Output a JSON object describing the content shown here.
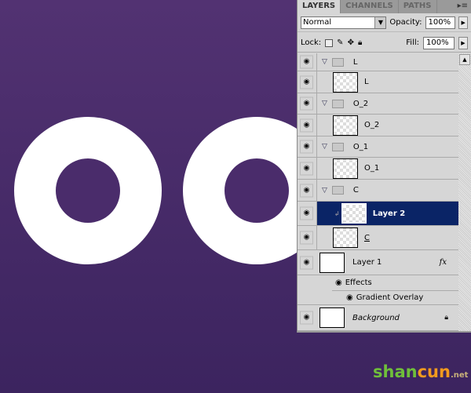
{
  "tabs": [
    "LAYERS",
    "CHANNELS",
    "PATHS"
  ],
  "blend_mode": "Normal",
  "opacity_label": "Opacity:",
  "opacity": "100%",
  "lock_label": "Lock:",
  "fill_label": "Fill:",
  "fill": "100%",
  "layers": [
    {
      "name": "L",
      "type": "group"
    },
    {
      "name": "L",
      "type": "layer"
    },
    {
      "name": "O_2",
      "type": "group"
    },
    {
      "name": "O_2",
      "type": "layer"
    },
    {
      "name": "O_1",
      "type": "group"
    },
    {
      "name": "O_1",
      "type": "layer"
    },
    {
      "name": "C",
      "type": "group"
    },
    {
      "name": "Layer 2",
      "type": "layer",
      "selected": true
    },
    {
      "name": "C",
      "type": "layer"
    },
    {
      "name": "Layer 1",
      "type": "layer",
      "fx": "fx"
    },
    {
      "name": "Effects",
      "type": "effects"
    },
    {
      "name": "Gradient Overlay",
      "type": "effect"
    },
    {
      "name": "Background",
      "type": "background"
    }
  ],
  "watermark": {
    "shan": "shan",
    "cun": "cun",
    "suffix": ".net"
  },
  "colors": {
    "bg_top": "#523272",
    "bg_bottom": "#3c245f",
    "selected": "#0a2466"
  }
}
